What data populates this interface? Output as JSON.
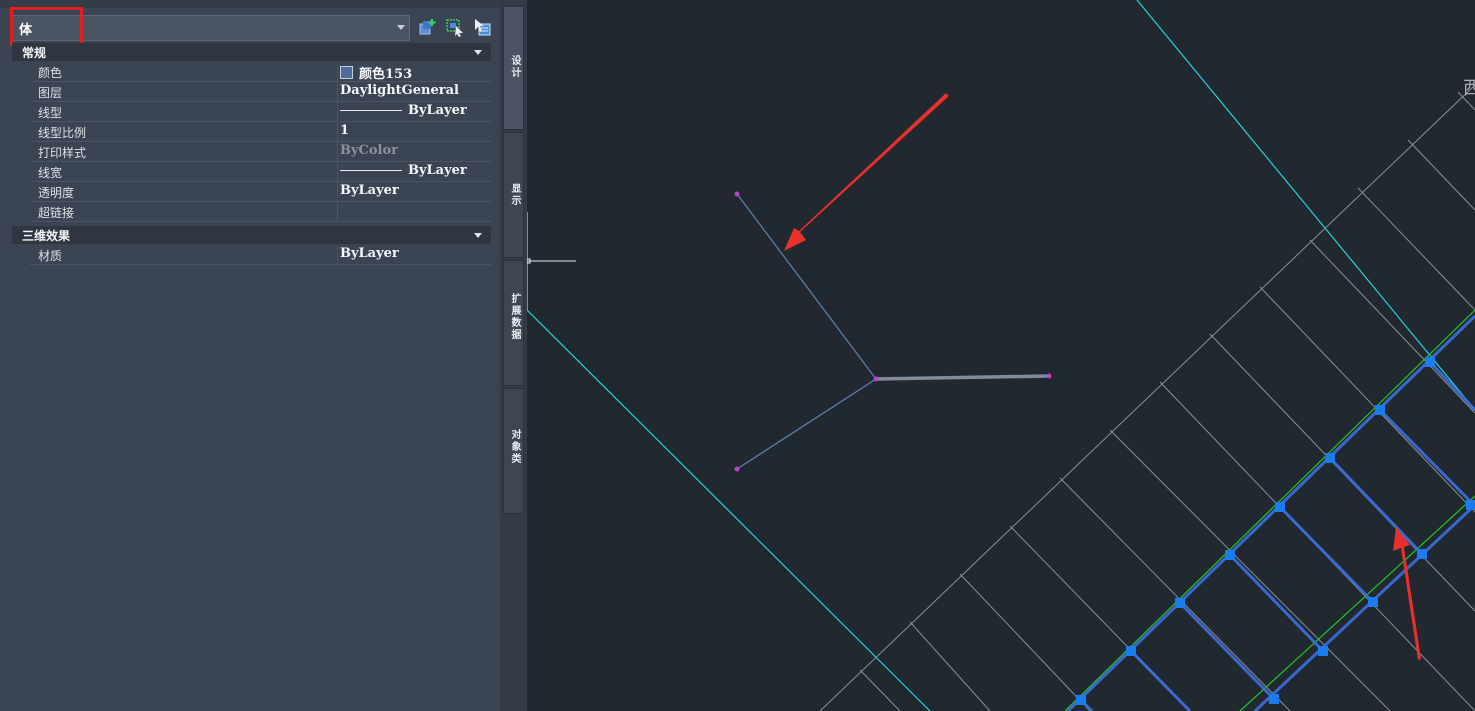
{
  "palette": {
    "selected_object": "体",
    "sections": {
      "general": "常规",
      "three_d": "三维效果"
    },
    "rows": [
      {
        "name": "颜色",
        "value": "颜色153",
        "swatch": "#4d6d9a"
      },
      {
        "name": "图层",
        "value": "DaylightGeneral"
      },
      {
        "name": "线型",
        "value": "ByLayer",
        "linetype": true
      },
      {
        "name": "线型比例",
        "value": "1"
      },
      {
        "name": "打印样式",
        "value": "ByColor",
        "dim": true
      },
      {
        "name": "线宽",
        "value": "ByLayer",
        "linetype": true
      },
      {
        "name": "透明度",
        "value": "ByLayer"
      },
      {
        "name": "超链接",
        "value": ""
      }
    ],
    "three_d_rows": [
      {
        "name": "材质",
        "value": "ByLayer"
      }
    ],
    "toolbar_icons": [
      "quick-select-icon",
      "select-objects-icon",
      "toggle-pickadd-icon"
    ]
  },
  "tabs": [
    "设计",
    "显示",
    "扩展数据",
    "对象类"
  ],
  "canvas": {
    "corner_text": "西",
    "colors": {
      "background": "#212830",
      "cyan": "#1fd6dd",
      "grid": "#8a8f96",
      "blue_wall": "#3b6fe0",
      "grip": "#1a7cf0",
      "green": "#22c822",
      "arrow": "#e8302c"
    }
  }
}
